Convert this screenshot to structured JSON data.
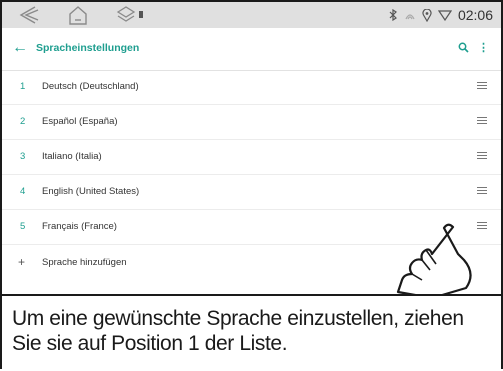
{
  "status": {
    "time": "02:06",
    "nav_icons": [
      "back-icon",
      "home-icon",
      "recents-icon"
    ],
    "indicator_icons": [
      "bluetooth-icon",
      "signal-icon",
      "location-icon",
      "wifi-icon"
    ]
  },
  "header": {
    "back_symbol": "←",
    "title": "Spracheinstellungen",
    "search_symbol": "🔍",
    "more_symbol": "⋮"
  },
  "languages": [
    {
      "number": "1",
      "label": "Deutsch (Deutschland)"
    },
    {
      "number": "2",
      "label": "Español (España)"
    },
    {
      "number": "3",
      "label": "Italiano (Italia)"
    },
    {
      "number": "4",
      "label": "English (United States)"
    },
    {
      "number": "5",
      "label": "Français (France)"
    }
  ],
  "add_language": {
    "symbol": "+",
    "label": "Sprache hinzufügen"
  },
  "caption": "Um eine gewünschte Sprache einzustellen, ziehen Sie sie auf Position 1 der Liste.",
  "colors": {
    "accent": "#1e9e8f",
    "statusbar": "#e0e0e0",
    "text": "#333333"
  }
}
